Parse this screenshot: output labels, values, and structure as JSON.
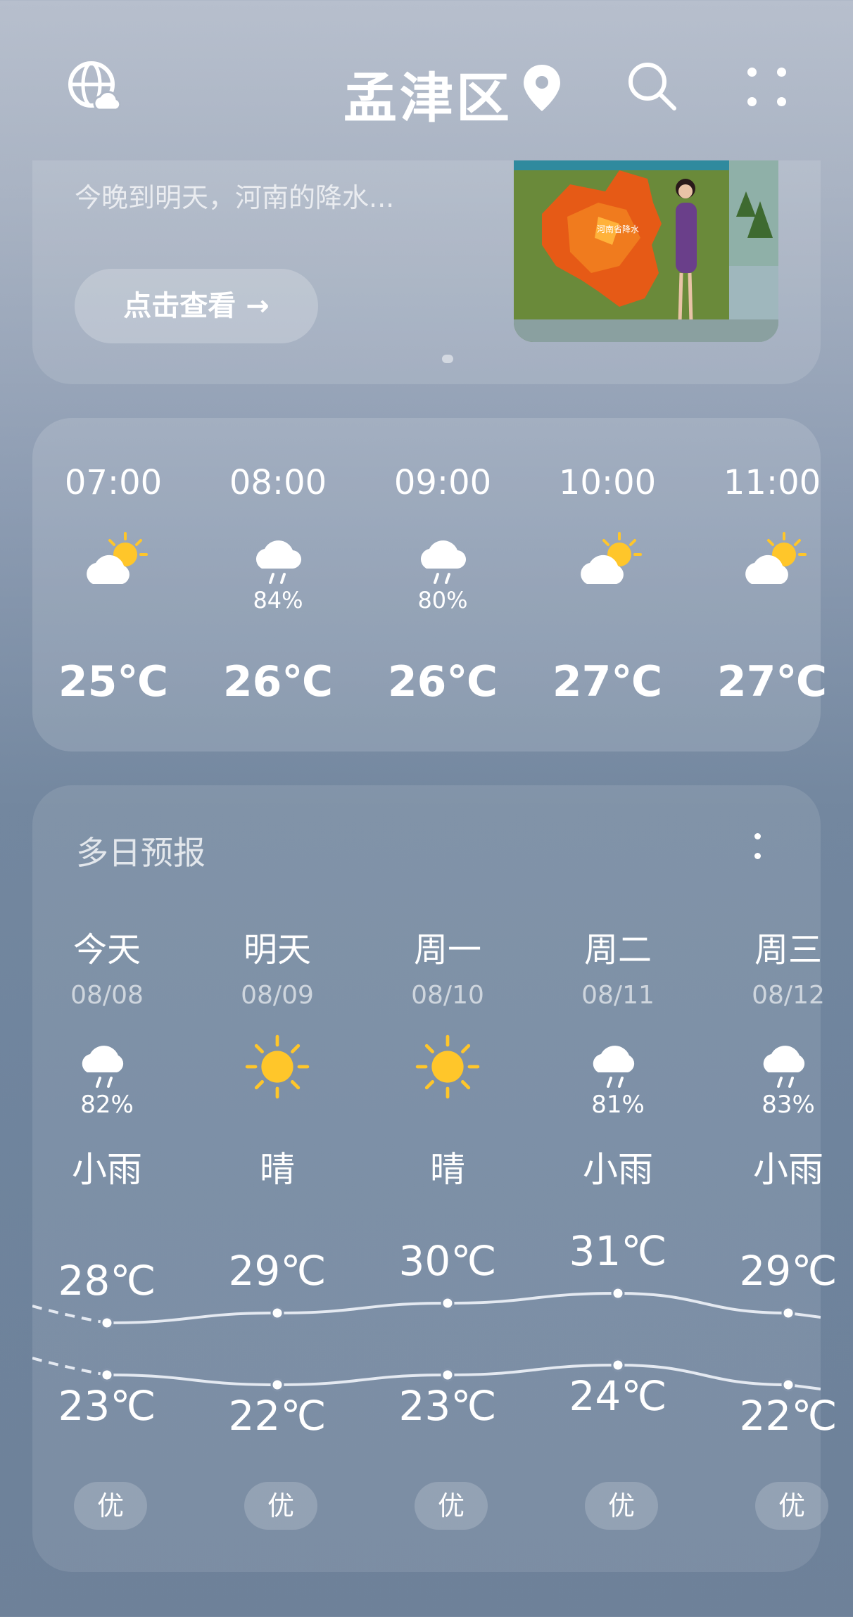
{
  "header": {
    "city": "孟津区"
  },
  "banner": {
    "headline": "今晚到明天，河南的降水...",
    "button_label": "点击查看 →",
    "map_caption": "河南省降水"
  },
  "hourly": [
    {
      "time": "07:00",
      "icon": "partly-sunny-icon",
      "precip": "",
      "temp": "25℃"
    },
    {
      "time": "08:00",
      "icon": "light-rain-icon",
      "precip": "84%",
      "temp": "26℃"
    },
    {
      "time": "09:00",
      "icon": "light-rain-icon",
      "precip": "80%",
      "temp": "26℃"
    },
    {
      "time": "10:00",
      "icon": "partly-sunny-icon",
      "precip": "",
      "temp": "27℃"
    },
    {
      "time": "11:00",
      "icon": "partly-sunny-icon",
      "precip": "",
      "temp": "27℃"
    }
  ],
  "daily": {
    "title": "多日预报",
    "days": [
      {
        "day": "今天",
        "date": "08/08",
        "icon": "light-rain-icon",
        "precip": "82%",
        "condition": "小雨",
        "high": "28℃",
        "low": "23℃",
        "aqi": "优"
      },
      {
        "day": "明天",
        "date": "08/09",
        "icon": "sun-icon",
        "precip": "",
        "condition": "晴",
        "high": "29℃",
        "low": "22℃",
        "aqi": "优"
      },
      {
        "day": "周一",
        "date": "08/10",
        "icon": "sun-icon",
        "precip": "",
        "condition": "晴",
        "high": "30℃",
        "low": "23℃",
        "aqi": "优"
      },
      {
        "day": "周二",
        "date": "08/11",
        "icon": "light-rain-icon",
        "precip": "81%",
        "condition": "小雨",
        "high": "31℃",
        "low": "24℃",
        "aqi": "优"
      },
      {
        "day": "周三",
        "date": "08/12",
        "icon": "light-rain-icon",
        "precip": "83%",
        "condition": "小雨",
        "high": "29℃",
        "low": "22℃",
        "aqi": "优"
      }
    ],
    "high_values": [
      28,
      29,
      30,
      31,
      29
    ],
    "low_values": [
      23,
      22,
      23,
      24,
      22
    ]
  },
  "colors": {
    "sun": "#ffc62a",
    "cloud": "#ffffff",
    "line": "#e4e9f1"
  }
}
